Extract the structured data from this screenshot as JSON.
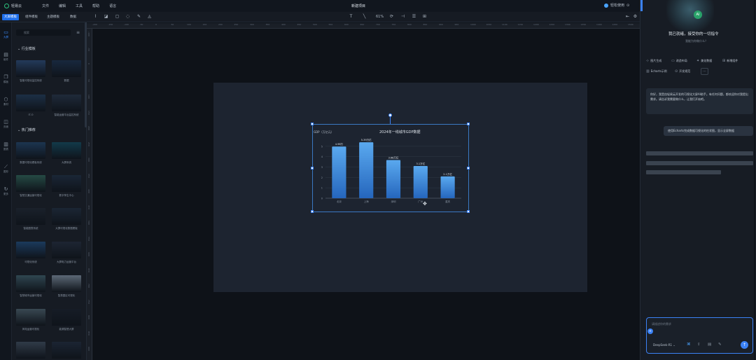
{
  "menu": {
    "app_name": "轻易云",
    "items": [
      "文件",
      "编辑",
      "工具",
      "帮助",
      "语言"
    ],
    "doc_title": "新建项目",
    "user_label": "轻松使用"
  },
  "toolbar": {
    "tabs": [
      "大屏模板",
      "组件模板",
      "主题模板",
      "数据"
    ],
    "zoom": "61%"
  },
  "rail": {
    "items": [
      {
        "icon": "monitor-icon",
        "label": "大屏",
        "active": true
      },
      {
        "icon": "component-icon",
        "label": "组件",
        "active": false
      },
      {
        "icon": "copy-icon",
        "label": "模板",
        "active": false
      },
      {
        "icon": "cube-icon",
        "label": "素材",
        "active": false
      },
      {
        "icon": "layout-icon",
        "label": "页面",
        "active": false
      },
      {
        "icon": "chart-icon",
        "label": "图表",
        "active": false
      },
      {
        "icon": "trend-icon",
        "label": "图形",
        "active": false
      },
      {
        "icon": "refresh-icon",
        "label": "更多",
        "active": false
      }
    ]
  },
  "panel": {
    "search_placeholder": "搜索",
    "sections": [
      "行业模板",
      "热门推荐"
    ],
    "templates": [
      {
        "caption": "智能可视化监控系统",
        "color": "#233a5a"
      },
      {
        "caption": "数据",
        "color": "#18283e"
      },
      {
        "caption": "IT-O",
        "color": "#1c2f45"
      },
      {
        "caption": "智能运营平台监控系统",
        "color": "#1f2a3a"
      },
      {
        "caption": "数据可视化看板系统",
        "color": "#1c3550"
      },
      {
        "caption": "大屏系统",
        "color": "#123a4a"
      },
      {
        "caption": "智慧交通运营可视化",
        "color": "#254a44"
      },
      {
        "caption": "数字孪生中心",
        "color": "#1a2636"
      },
      {
        "caption": "智能图表系统",
        "color": "#1a212b"
      },
      {
        "caption": "大屏可视化数据看板",
        "color": "#1b2634"
      },
      {
        "caption": "可视化系统",
        "color": "#1b3a5c"
      },
      {
        "caption": "大屏电力运营平台",
        "color": "#1d2533"
      },
      {
        "caption": "智慧城市运营可视化",
        "color": "#2f4650"
      },
      {
        "caption": "智慧园区可视化",
        "color": "#5c6876"
      },
      {
        "caption": "风电运营可视化",
        "color": "#394852"
      },
      {
        "caption": "能源智慧大屏",
        "color": "#161c26"
      },
      {
        "caption": "",
        "color": "#303b48"
      },
      {
        "caption": "",
        "color": "#1b2433"
      }
    ]
  },
  "ruler": {
    "top": [
      "-200",
      "-150",
      "-100",
      "-50",
      "0",
      "50",
      "100",
      "150",
      "200",
      "250",
      "300",
      "350",
      "400",
      "450",
      "500",
      "550",
      "600",
      "650",
      "700",
      "750",
      "800",
      "850",
      "900",
      "950",
      "1000",
      "1050",
      "1100",
      "1150",
      "1200",
      "1250",
      "1300",
      "1350",
      "1400",
      "1450",
      "1500"
    ],
    "left": [
      "-100",
      "-50",
      "0",
      "50",
      "100",
      "150",
      "200",
      "250",
      "300",
      "350",
      "400",
      "450",
      "500",
      "550",
      "600",
      "650",
      "700",
      "750",
      "800",
      "850",
      "900"
    ]
  },
  "chart_data": {
    "type": "bar",
    "title": "2024年一线城市GDP数据",
    "ylabel": "GDP（万亿元）",
    "categories": [
      "北京",
      "上海",
      "深圳",
      "广州",
      "重庆"
    ],
    "values": [
      4.98,
      5.39,
      3.68,
      3.1,
      2.1
    ],
    "data_labels": [
      "4.98万",
      "5.39万亿",
      "3.68万亿",
      "3.1万亿",
      "2.1万亿"
    ],
    "yticks": [
      0,
      1,
      2,
      3,
      4,
      5
    ],
    "ylim": [
      0,
      5.6
    ],
    "bar_color_top": "#5aa9ef",
    "bar_color_bottom": "#2566bd",
    "grid": true
  },
  "ai": {
    "greeting": "我已就绪，接受你的一切指令",
    "sub": "我能为你做什么？",
    "chips": [
      "图片生成",
      "改造布局",
      "美化数据",
      "新增组件",
      "Echarts示例",
      "开发规范"
    ],
    "bubble": "你好，我是由轻易云开发的可视化大屏AI助手。有任何问题，都欢迎你对我提出需求。请告诉我需要做什么，让我们开始吧。",
    "user_msg": "使用Echarts完成数据可视化的柱状图，显示全屏数据",
    "input_placeholder": "请描述你的需求",
    "model_label": "DeepSeek-R1",
    "accent": "#3b82f6"
  }
}
